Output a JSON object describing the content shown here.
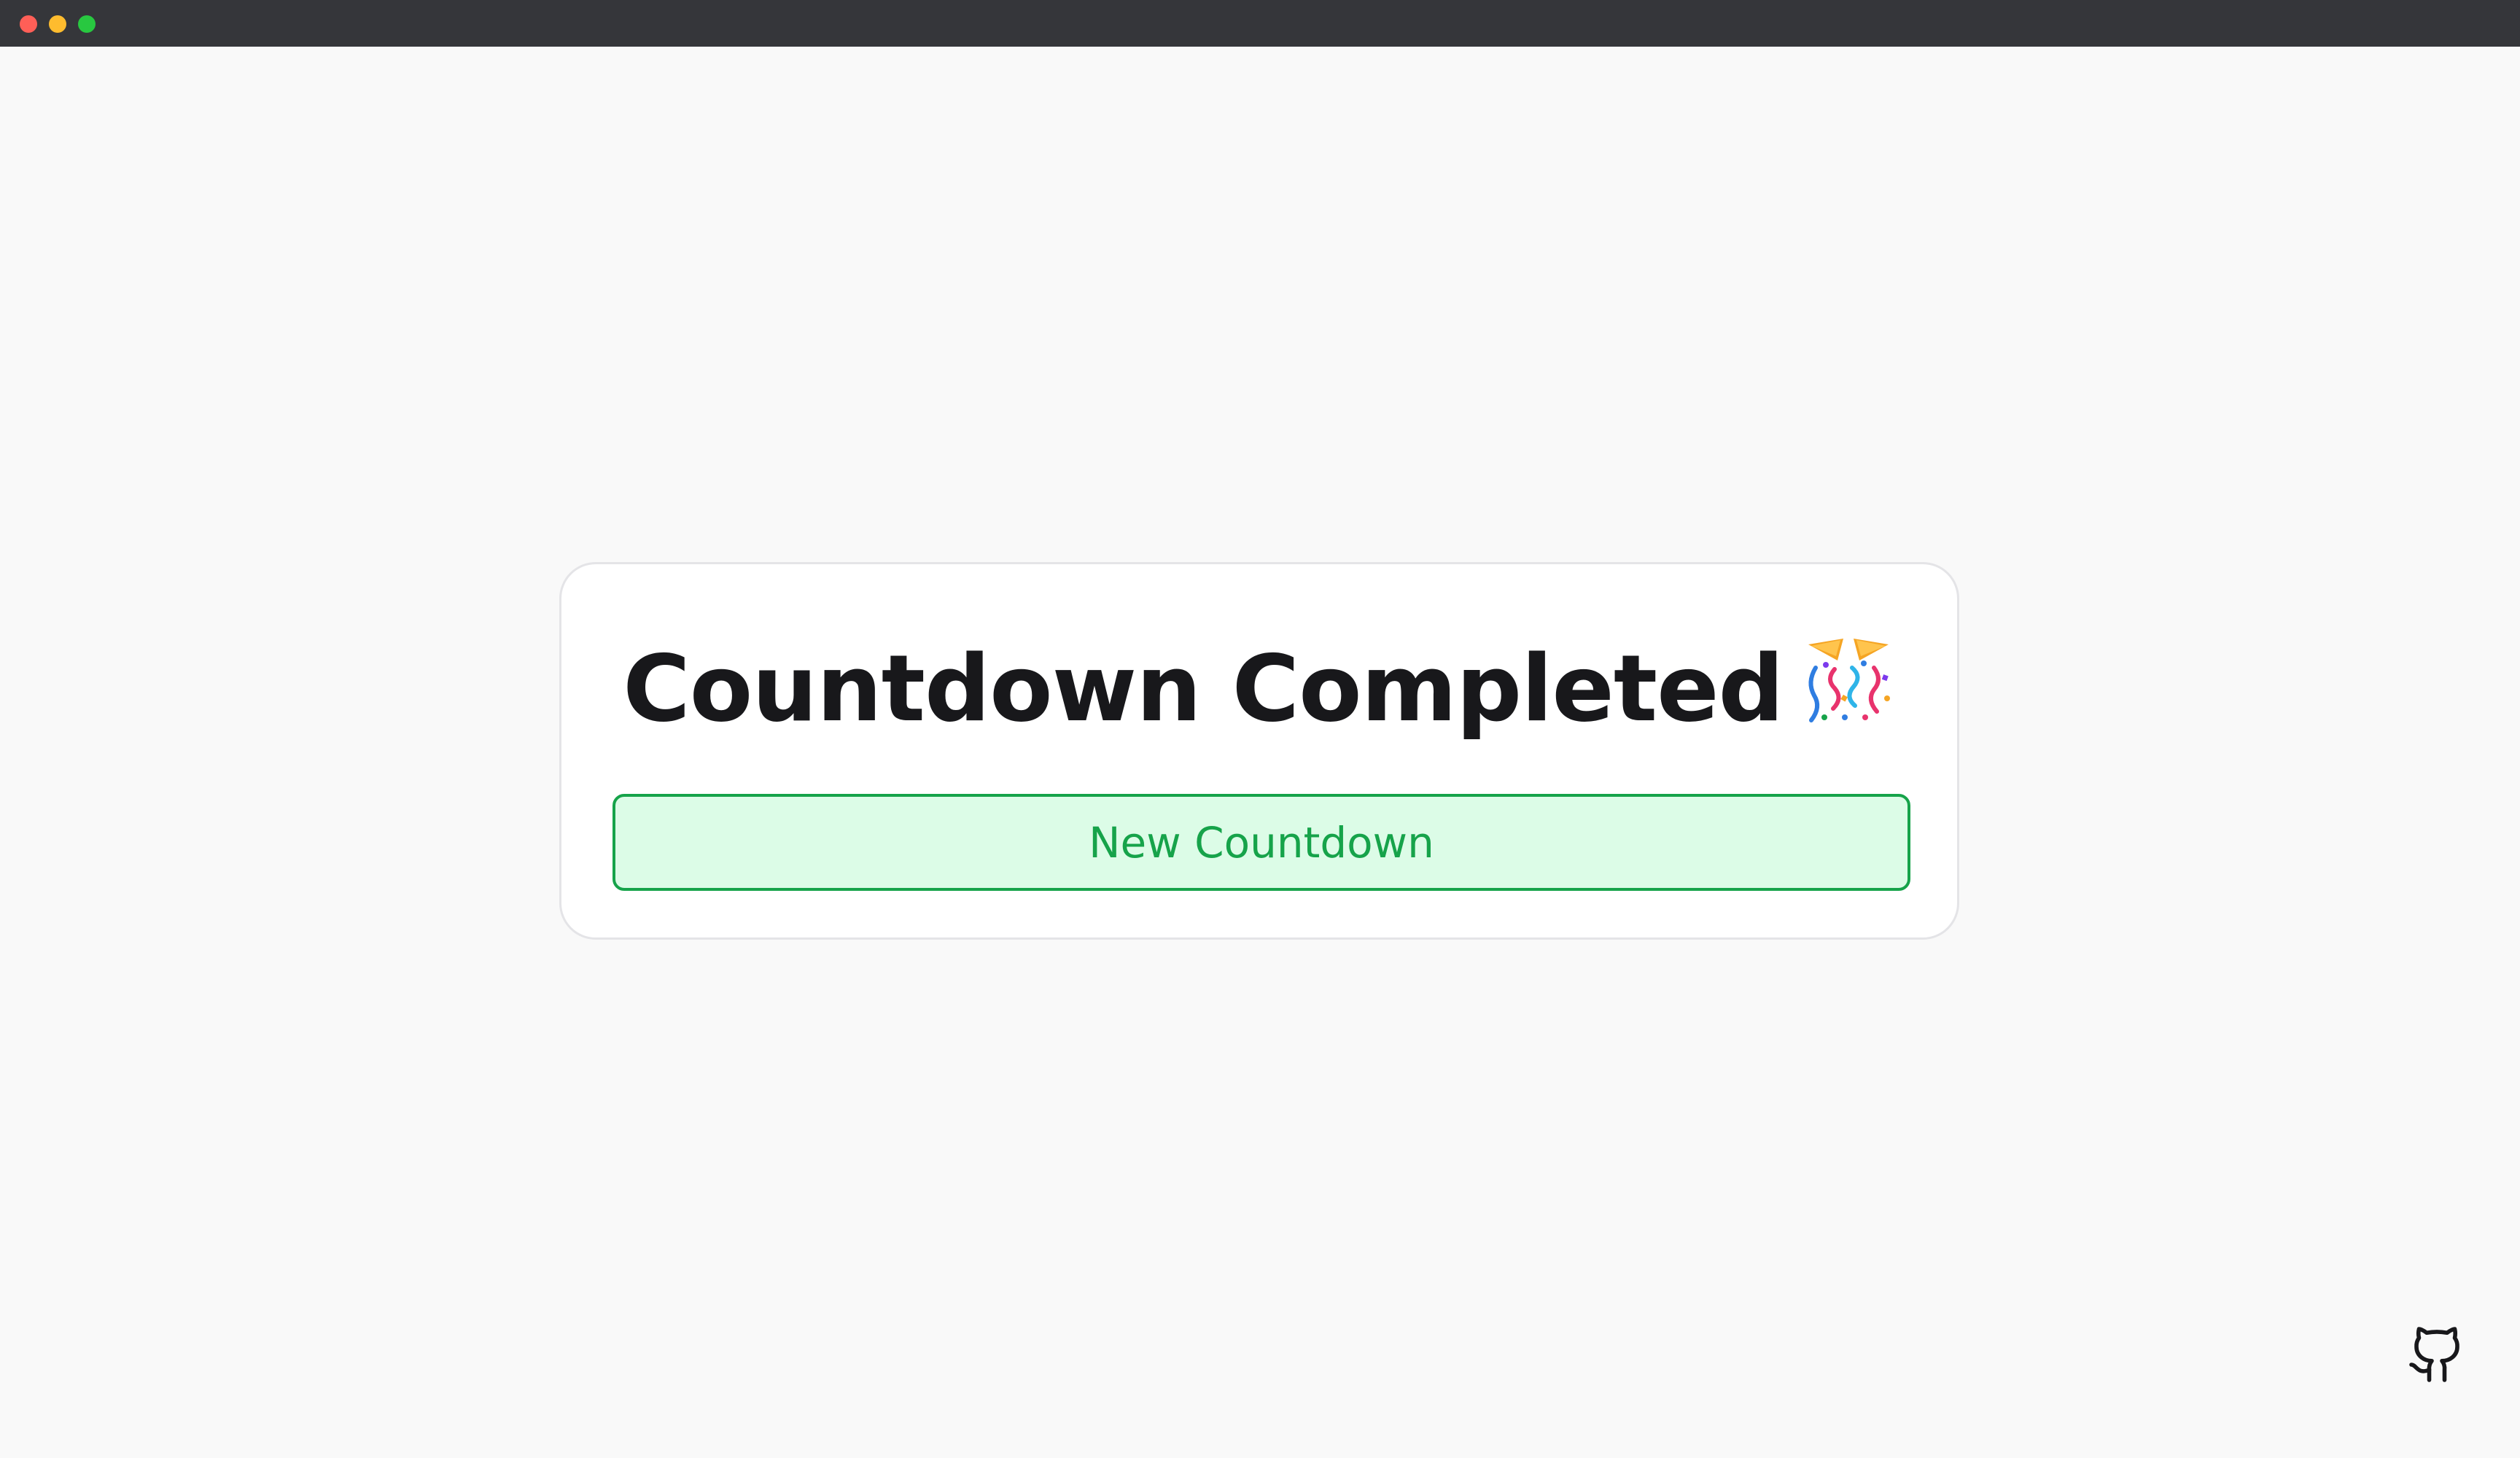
{
  "window": {
    "controls": [
      "close",
      "minimize",
      "zoom"
    ],
    "colors": {
      "close": "#ff5f57",
      "minimize": "#febc2e",
      "zoom": "#28c840",
      "titlebar": "#35363a"
    }
  },
  "card": {
    "title": "Countdown Completed",
    "emoji_icon": "party-popper-icon",
    "button_label": "New Countdown"
  },
  "footer": {
    "github_icon": "github-icon"
  },
  "colors": {
    "background": "#f9f9f9",
    "card_border": "#e4e4e7",
    "title_text": "#18181b",
    "button_bg": "#dcfce7",
    "button_accent": "#16a34a"
  }
}
